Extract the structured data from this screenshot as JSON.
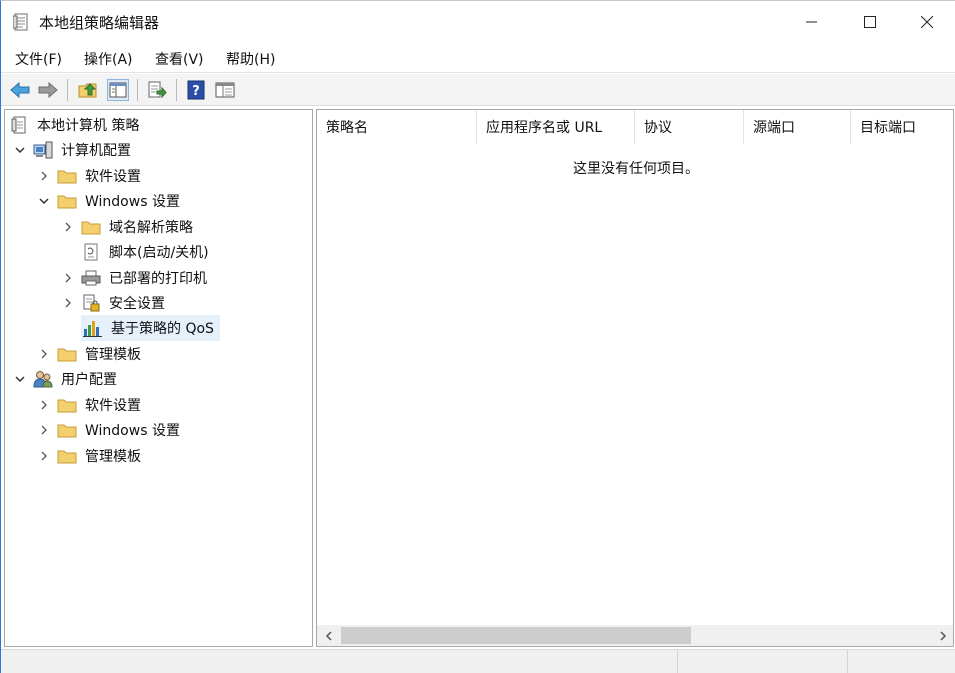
{
  "window": {
    "title": "本地组策略编辑器"
  },
  "menu": [
    {
      "label": "文件(F)"
    },
    {
      "label": "操作(A)"
    },
    {
      "label": "查看(V)"
    },
    {
      "label": "帮助(H)"
    }
  ],
  "toolbar": {
    "buttons": [
      "back-arrow-icon",
      "forward-arrow-icon",
      "up-folder-icon",
      "show-hide-tree-icon",
      "export-list-icon",
      "help-icon",
      "properties-icon"
    ]
  },
  "tree": {
    "root": "本地计算机 策略",
    "computer_config": "计算机配置",
    "software_settings": "软件设置",
    "windows_settings": "Windows 设置",
    "dns_policy": "域名解析策略",
    "scripts": "脚本(启动/关机)",
    "printers": "已部署的打印机",
    "security_settings": "安全设置",
    "qos": "基于策略的 QoS",
    "admin_templates": "管理模板",
    "user_config": "用户配置",
    "user_software_settings": "软件设置",
    "user_windows_settings": "Windows 设置",
    "user_admin_templates": "管理模板"
  },
  "list": {
    "columns": [
      "策略名",
      "应用程序名或 URL",
      "协议",
      "源端口",
      "目标端口"
    ],
    "empty_message": "这里没有任何项目。"
  },
  "colors": {
    "accent_border": "#2b78d6",
    "selection": "#e5f0fb",
    "folder": "#f3cf6e"
  }
}
